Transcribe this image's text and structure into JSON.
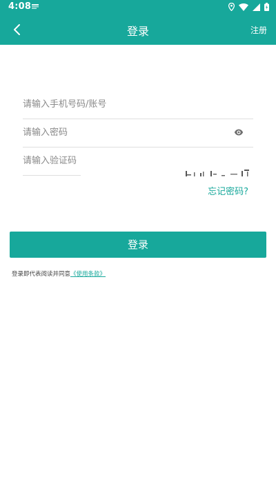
{
  "status_bar": {
    "time": "4:08",
    "icons": [
      "location-icon",
      "wifi-icon",
      "signal-icon",
      "battery-icon"
    ]
  },
  "app_bar": {
    "title": "登录",
    "right_action": "注册",
    "back_icon": "chevron-left-icon"
  },
  "form": {
    "phone_placeholder": "请输入手机号码/账号",
    "password_placeholder": "请输入密码",
    "code_placeholder": "请输入验证码",
    "password_toggle_icon": "eye-icon"
  },
  "forgot_password": "忘记密码?",
  "login_button": "登录",
  "terms": {
    "prefix": "登录即代表阅读并同意",
    "link": "《使用条款》"
  },
  "colors": {
    "primary": "#17a89b",
    "text": "#333333",
    "placeholder": "#8a8a8a",
    "divider": "#dedede"
  }
}
